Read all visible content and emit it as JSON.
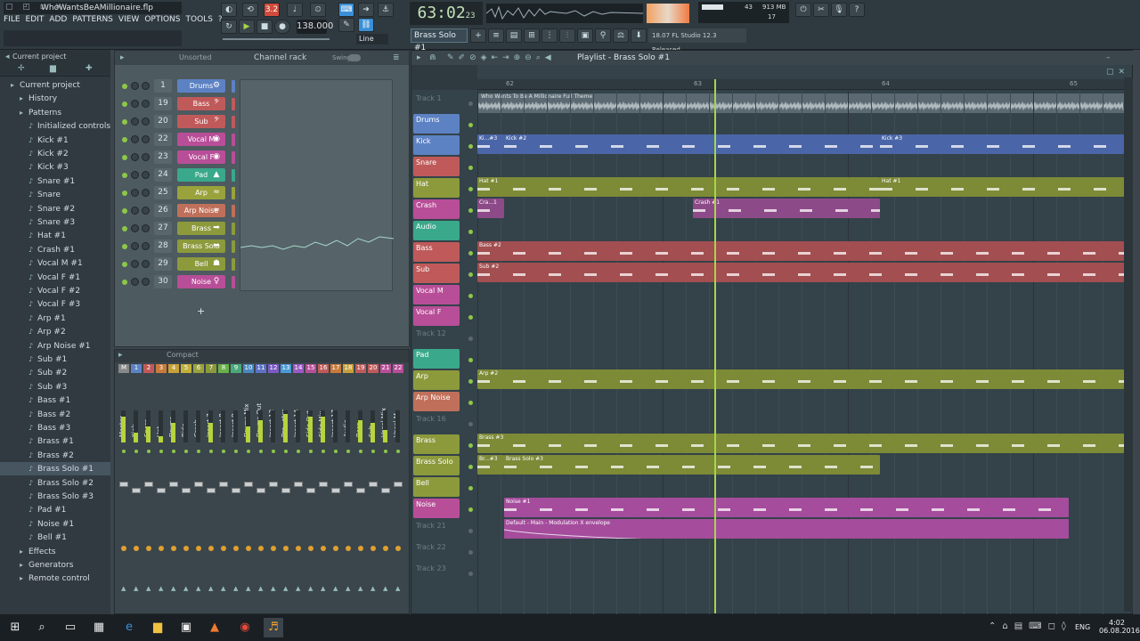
{
  "window": {
    "title": "WhoWantsBeAMillionaire.flp"
  },
  "menu": [
    "FILE",
    "EDIT",
    "ADD",
    "PATTERNS",
    "VIEW",
    "OPTIONS",
    "TOOLS",
    "?"
  ],
  "transport": {
    "tempo": "138.000",
    "song_time": "63:02",
    "song_time_sub": "23",
    "snap_mode": "Line",
    "pattern": "Brass Solo #1",
    "news": "18.07  FL Studio 12.3 Released",
    "cpu": "43",
    "ram": "913 MB",
    "poly": "17"
  },
  "browser": {
    "title": "Current project",
    "items": [
      {
        "label": "Current project",
        "icon": "folder-icon",
        "indent": 0
      },
      {
        "label": "History",
        "icon": "history-icon",
        "indent": 1
      },
      {
        "label": "Patterns",
        "icon": "pattern-icon",
        "indent": 1
      },
      {
        "label": "Initialized controls",
        "indent": 2
      },
      {
        "label": "Kick #1",
        "indent": 2
      },
      {
        "label": "Kick #2",
        "indent": 2
      },
      {
        "label": "Kick #3",
        "indent": 2
      },
      {
        "label": "Snare #1",
        "indent": 2
      },
      {
        "label": "Snare",
        "indent": 2
      },
      {
        "label": "Snare #2",
        "indent": 2
      },
      {
        "label": "Snare #3",
        "indent": 2
      },
      {
        "label": "Hat #1",
        "indent": 2
      },
      {
        "label": "Crash #1",
        "indent": 2
      },
      {
        "label": "Vocal M #1",
        "indent": 2
      },
      {
        "label": "Vocal F #1",
        "indent": 2
      },
      {
        "label": "Vocal F #2",
        "indent": 2
      },
      {
        "label": "Vocal F #3",
        "indent": 2
      },
      {
        "label": "Arp #1",
        "indent": 2
      },
      {
        "label": "Arp #2",
        "indent": 2
      },
      {
        "label": "Arp Noise #1",
        "indent": 2
      },
      {
        "label": "Sub #1",
        "indent": 2
      },
      {
        "label": "Sub #2",
        "indent": 2
      },
      {
        "label": "Sub #3",
        "indent": 2
      },
      {
        "label": "Bass #1",
        "indent": 2
      },
      {
        "label": "Bass #2",
        "indent": 2
      },
      {
        "label": "Bass #3",
        "indent": 2
      },
      {
        "label": "Brass #1",
        "indent": 2
      },
      {
        "label": "Brass #2",
        "indent": 2
      },
      {
        "label": "Brass Solo #1",
        "indent": 2,
        "selected": true
      },
      {
        "label": "Brass Solo #2",
        "indent": 2
      },
      {
        "label": "Brass Solo #3",
        "indent": 2
      },
      {
        "label": "Pad #1",
        "indent": 2
      },
      {
        "label": "Noise #1",
        "indent": 2
      },
      {
        "label": "Bell #1",
        "indent": 2
      },
      {
        "label": "Effects",
        "indent": 1
      },
      {
        "label": "Generators",
        "indent": 1
      },
      {
        "label": "Remote control",
        "indent": 1
      }
    ]
  },
  "channel_rack": {
    "title": "Channel rack",
    "filter": "Unsorted",
    "swing": "Swing",
    "channels": [
      {
        "num": "1",
        "name": "Drums",
        "color": "#5d82c4",
        "icon": "⚙"
      },
      {
        "num": "19",
        "name": "Bass",
        "color": "#c05a5a",
        "icon": "𝄢"
      },
      {
        "num": "20",
        "name": "Sub",
        "color": "#c05a5a",
        "icon": "𝄢"
      },
      {
        "num": "22",
        "name": "Vocal M",
        "color": "#b84e98",
        "icon": "◉"
      },
      {
        "num": "23",
        "name": "Vocal F",
        "color": "#b84e98",
        "icon": "◉"
      },
      {
        "num": "24",
        "name": "Pad",
        "color": "#3aa88a",
        "icon": "▲"
      },
      {
        "num": "25",
        "name": "Arp",
        "color": "#9aa23c",
        "icon": "≈"
      },
      {
        "num": "26",
        "name": "Arp Noise",
        "color": "#c0705a",
        "icon": "≈"
      },
      {
        "num": "27",
        "name": "Brass",
        "color": "#8c9a3c",
        "icon": "➡"
      },
      {
        "num": "28",
        "name": "Brass Solo",
        "color": "#8c9a3c",
        "icon": "➡"
      },
      {
        "num": "29",
        "name": "Bell",
        "color": "#8c9a3c",
        "icon": "☗"
      },
      {
        "num": "30",
        "name": "Noise",
        "color": "#b84e98",
        "icon": "♀"
      }
    ]
  },
  "mixer": {
    "title": "Compact",
    "tracks": [
      {
        "num": "M",
        "name": "Master",
        "level": 0.8
      },
      {
        "num": "1",
        "name": "Kick",
        "level": 0.3
      },
      {
        "num": "2",
        "name": "Snare",
        "level": 0.5
      },
      {
        "num": "3",
        "name": "Hat",
        "level": 0.2
      },
      {
        "num": "4",
        "name": "Drums",
        "level": 0.6
      },
      {
        "num": "5",
        "name": "Ride",
        "level": 0.0
      },
      {
        "num": "6",
        "name": "Crash",
        "level": 0.0
      },
      {
        "num": "7",
        "name": "Insert 7",
        "level": 0.6
      },
      {
        "num": "8",
        "name": "Insert 8",
        "level": 0.0
      },
      {
        "num": "9",
        "name": "Insert 9",
        "level": 0.0
      },
      {
        "num": "10",
        "name": "Drums Mix",
        "level": 0.5
      },
      {
        "num": "11",
        "name": "Drums Out",
        "level": 0.7
      },
      {
        "num": "12",
        "name": "Insert 12",
        "level": 0.0
      },
      {
        "num": "13",
        "name": "Pre...ster",
        "level": 0.9
      },
      {
        "num": "14",
        "name": "Insert 14",
        "level": 0.0
      },
      {
        "num": "15",
        "name": "Side Out",
        "level": 0.8
      },
      {
        "num": "16",
        "name": "Side Mix",
        "level": 0.8
      },
      {
        "num": "17",
        "name": "Insert 17",
        "level": 0.0
      },
      {
        "num": "18",
        "name": "Audio",
        "level": 0.0
      },
      {
        "num": "19",
        "name": "Bass",
        "level": 0.7
      },
      {
        "num": "20",
        "name": "Sub",
        "level": 0.6
      },
      {
        "num": "21",
        "name": "Vocal Mix",
        "level": 0.4
      },
      {
        "num": "22",
        "name": "Vocal M",
        "level": 0.0
      }
    ]
  },
  "playlist": {
    "title": "Playlist - Brass Solo #1",
    "ruler": [
      "62",
      "63",
      "64",
      "65"
    ],
    "audio_label": "Who Wants To Be A Millionaire Full Theme",
    "tracks": [
      {
        "name": "Track 1",
        "color": "",
        "muted": true
      },
      {
        "name": "Drums",
        "color": "#5d82c4"
      },
      {
        "name": "Kick",
        "color": "#5d82c4"
      },
      {
        "name": "Snare",
        "color": "#c05a5a"
      },
      {
        "name": "Hat",
        "color": "#8c9a3c"
      },
      {
        "name": "Crash",
        "color": "#b84e98"
      },
      {
        "name": "Audio",
        "color": "#3aa88a"
      },
      {
        "name": "Bass",
        "color": "#c05a5a"
      },
      {
        "name": "Sub",
        "color": "#c05a5a"
      },
      {
        "name": "Vocal M",
        "color": "#b84e98"
      },
      {
        "name": "Vocal F",
        "color": "#b84e98"
      },
      {
        "name": "Track 12",
        "color": "",
        "muted": true
      },
      {
        "name": "Pad",
        "color": "#3aa88a"
      },
      {
        "name": "Arp",
        "color": "#8c9a3c"
      },
      {
        "name": "Arp Noise",
        "color": "#c0705a"
      },
      {
        "name": "Track 16",
        "color": "",
        "muted": true
      },
      {
        "name": "Brass",
        "color": "#8c9a3c"
      },
      {
        "name": "Brass Solo",
        "color": "#8c9a3c"
      },
      {
        "name": "Bell",
        "color": "#8c9a3c"
      },
      {
        "name": "Noise",
        "color": "#b84e98"
      },
      {
        "name": "Track 21",
        "color": "",
        "muted": true
      },
      {
        "name": "Track 22",
        "color": "",
        "muted": true
      },
      {
        "name": "Track 23",
        "color": "",
        "muted": true
      }
    ],
    "clips": [
      {
        "track": 2,
        "from": 0,
        "to": 30,
        "label": "Ki...#3",
        "color": "#4a66a8"
      },
      {
        "track": 2,
        "from": 30,
        "to": 452,
        "label": "Kick #2",
        "color": "#4a66a8"
      },
      {
        "track": 2,
        "from": 452,
        "to": 726,
        "label": "Kick #3",
        "color": "#4a66a8"
      },
      {
        "track": 4,
        "from": 0,
        "to": 452,
        "label": "Hat #1",
        "color": "#7d8a36"
      },
      {
        "track": 4,
        "from": 452,
        "to": 726,
        "label": "Hat #1",
        "color": "#7d8a36"
      },
      {
        "track": 5,
        "from": 0,
        "to": 30,
        "label": "Cra...1",
        "color": "#8d4a88"
      },
      {
        "track": 5,
        "from": 242,
        "to": 452,
        "label": "Crash #1",
        "color": "#8d4a88"
      },
      {
        "track": 7,
        "from": 0,
        "to": 726,
        "label": "Bass #2",
        "color": "#a34e50"
      },
      {
        "track": 8,
        "from": 0,
        "to": 726,
        "label": "Sub #2",
        "color": "#a34e50"
      },
      {
        "track": 13,
        "from": 0,
        "to": 726,
        "label": "Arp #2",
        "color": "#7d8a36"
      },
      {
        "track": 16,
        "from": 0,
        "to": 726,
        "label": "Brass #3",
        "color": "#7d8a36"
      },
      {
        "track": 17,
        "from": 0,
        "to": 30,
        "label": "Br...#3",
        "color": "#7d8a36"
      },
      {
        "track": 17,
        "from": 30,
        "to": 452,
        "label": "Brass Solo #3",
        "color": "#7d8a36"
      },
      {
        "track": 19,
        "from": 30,
        "to": 664,
        "label": "Noise #1",
        "color": "#a54c9c"
      },
      {
        "track": 20,
        "from": 30,
        "to": 664,
        "label": "Default - Main - Modulation X envelope",
        "color": "#a54c9c",
        "automation": true
      }
    ]
  },
  "taskbar": {
    "time": "4:02",
    "date": "06.08.2016",
    "lang": "ENG"
  }
}
